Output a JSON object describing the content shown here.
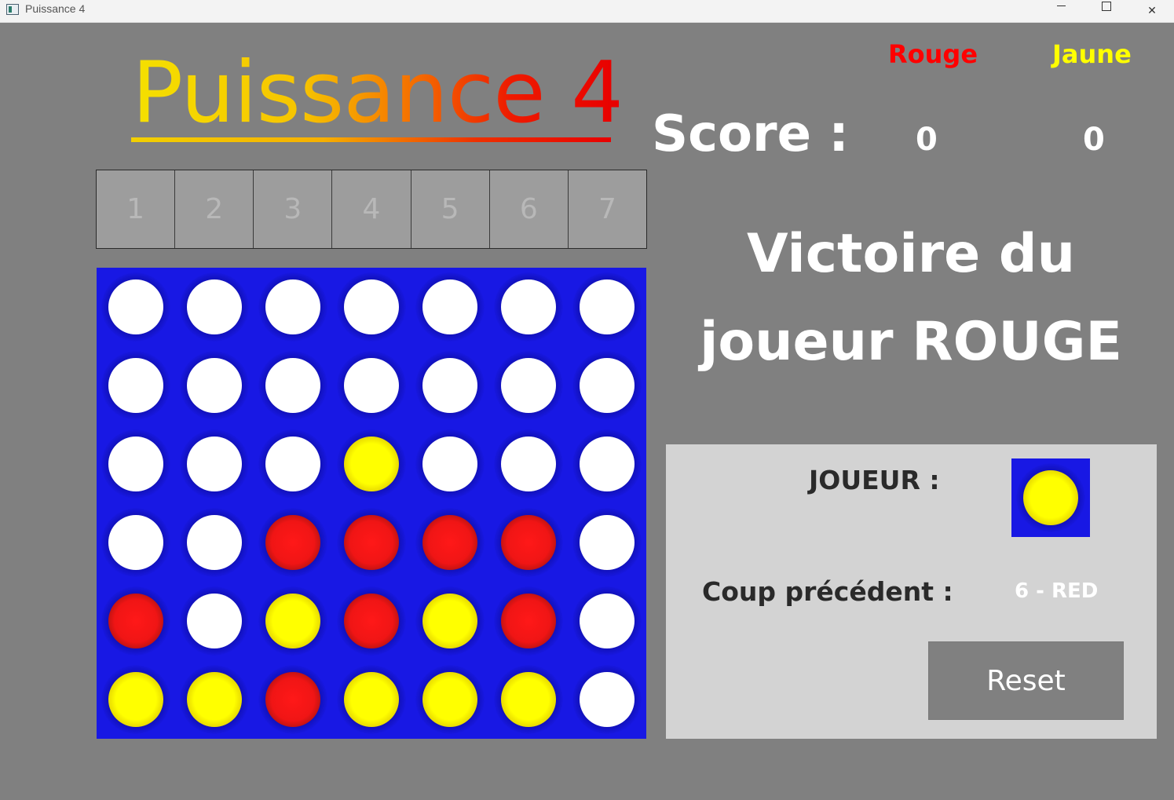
{
  "window": {
    "title": "Puissance 4",
    "controls": {
      "minimize": "minimize",
      "maximize": "maximize",
      "close": "✕"
    }
  },
  "game": {
    "title": "Puissance 4",
    "columns": [
      "1",
      "2",
      "3",
      "4",
      "5",
      "6",
      "7"
    ],
    "board": [
      [
        "white",
        "white",
        "white",
        "white",
        "white",
        "white",
        "white"
      ],
      [
        "white",
        "white",
        "white",
        "white",
        "white",
        "white",
        "white"
      ],
      [
        "white",
        "white",
        "white",
        "yellow",
        "white",
        "white",
        "white"
      ],
      [
        "white",
        "white",
        "red",
        "red",
        "red",
        "red",
        "white"
      ],
      [
        "red",
        "white",
        "yellow",
        "red",
        "yellow",
        "red",
        "white"
      ],
      [
        "yellow",
        "yellow",
        "red",
        "yellow",
        "yellow",
        "yellow",
        "white"
      ]
    ]
  },
  "scoreboard": {
    "red_label": "Rouge",
    "yellow_label": "Jaune",
    "score_label": "Score :",
    "red_score": "0",
    "yellow_score": "0"
  },
  "message": {
    "line1": "Victoire du",
    "line2": "joueur ROUGE"
  },
  "info": {
    "player_label": "JOUEUR :",
    "current_player_color": "yellow",
    "previous_move_label": "Coup précédent :",
    "previous_move_value": "6 - RED",
    "reset_label": "Reset"
  },
  "colors": {
    "board_blue": "#1818e4",
    "red": "#ff0000",
    "yellow": "#ffff00",
    "background": "#808080"
  }
}
